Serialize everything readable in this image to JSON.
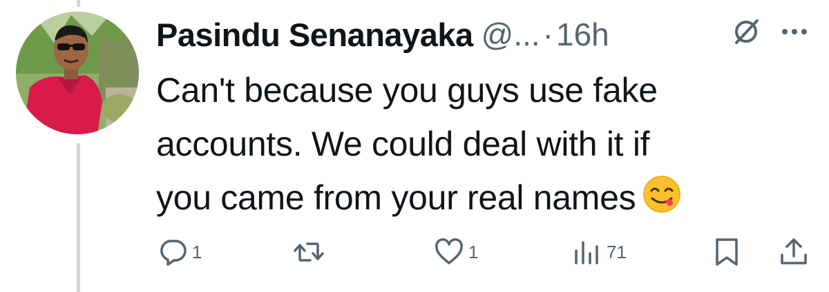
{
  "tweet": {
    "display_name": "Pasindu Senanayaka",
    "handle": "@...",
    "separator": "·",
    "time": "16h",
    "text_line1": "Can't because you guys use fake",
    "text_line2": "accounts. We could deal with it if",
    "text_line3": "you came from your real names",
    "emoji": "face-savoring-food-emoji"
  },
  "actions": {
    "reply_count": "1",
    "retweet_count": "",
    "like_count": "1",
    "views_count": "71"
  },
  "colors": {
    "text_primary": "#0f1419",
    "text_secondary": "#536471",
    "thread_line": "#cfd9de",
    "avatar_shirt": "#d81b4a"
  },
  "icons": [
    "grok-icon",
    "more-icon",
    "reply-icon",
    "retweet-icon",
    "like-icon",
    "views-icon",
    "bookmark-icon",
    "share-icon"
  ]
}
